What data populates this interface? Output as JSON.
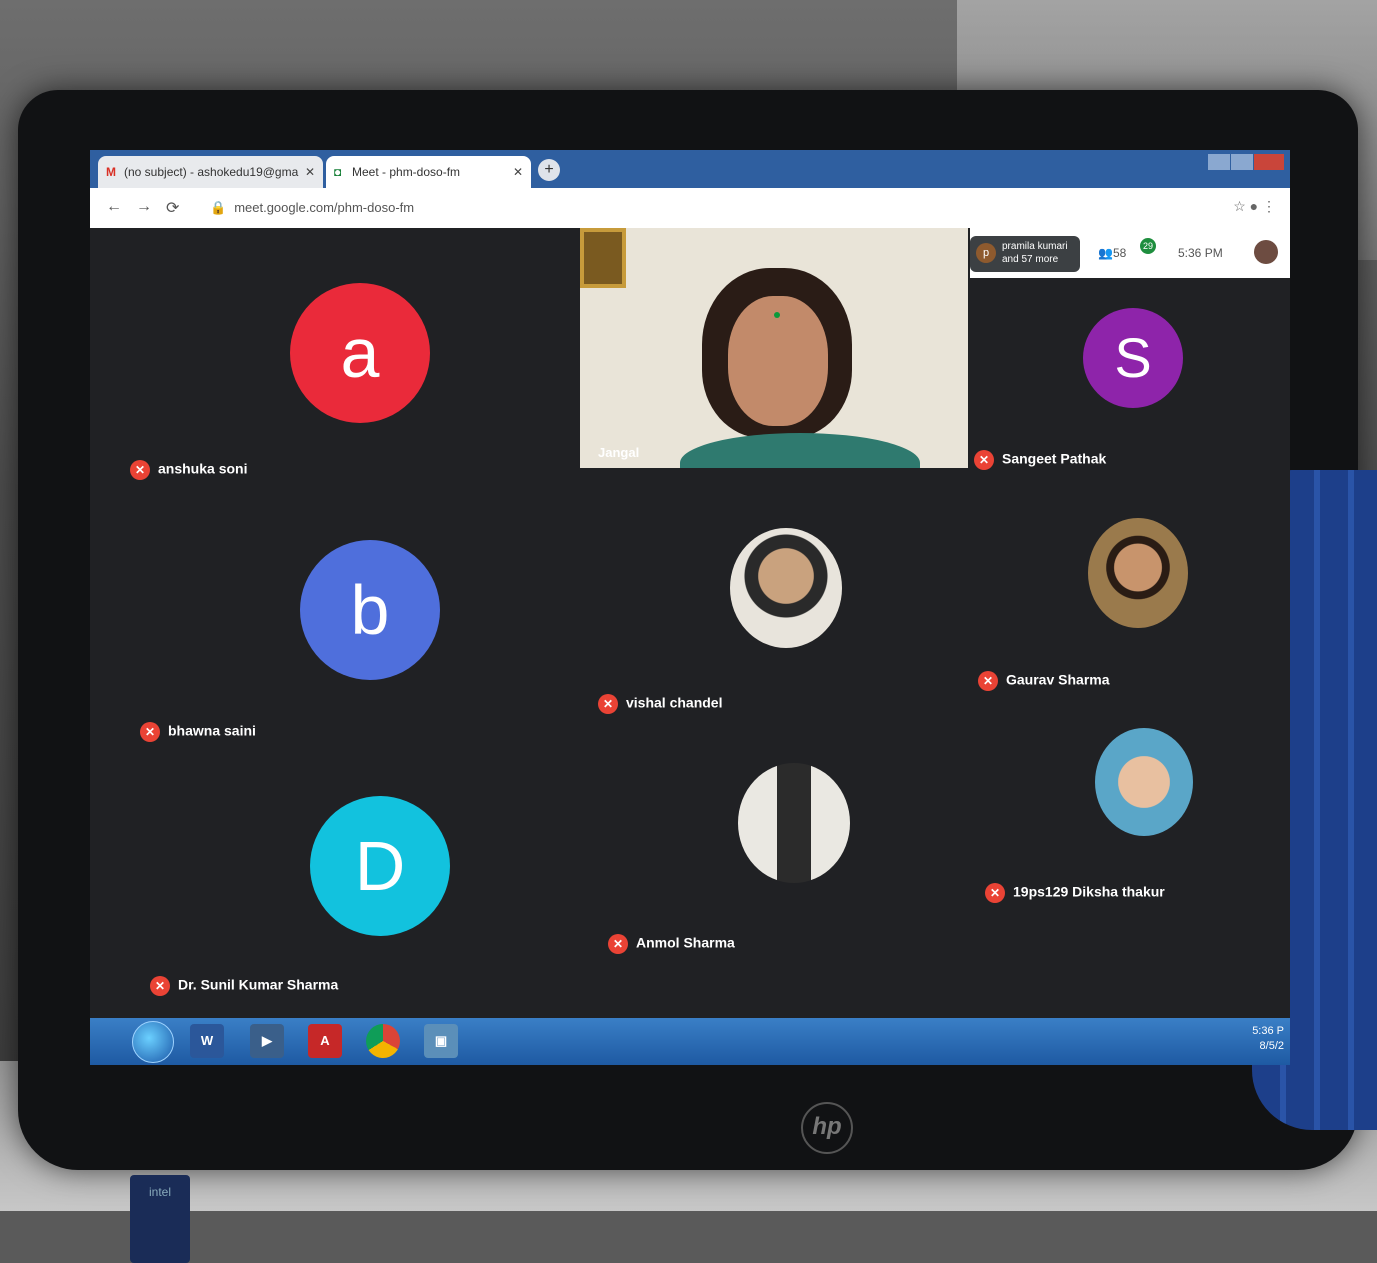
{
  "browser": {
    "tabs": [
      {
        "label": "(no subject) - ashokedu19@gma",
        "icon": "gmail-icon"
      },
      {
        "label": "Meet - phm-doso-fm",
        "icon": "meet-icon"
      }
    ],
    "url": "meet.google.com/phm-doso-fm"
  },
  "meet": {
    "participants": [
      {
        "name": "anshuka soni",
        "initial": "a",
        "color": "#ea2a3a"
      },
      {
        "name": "bhawna saini",
        "initial": "b",
        "color": "#4f6fdc"
      },
      {
        "name": "Dr. Sunil Kumar Sharma",
        "initial": "D",
        "color": "#12c2de"
      },
      {
        "name": "Sangeet Pathak",
        "initial": "S",
        "color": "#8e24aa"
      },
      {
        "name": "vishal chandel"
      },
      {
        "name": "Gaurav Sharma"
      },
      {
        "name": "Anmol Sharma"
      },
      {
        "name": "19ps129 Diksha thakur"
      }
    ],
    "speaker_label": "Jangal",
    "people_chip": {
      "initial": "p",
      "line1": "pramila kumari",
      "line2": "and 57 more"
    },
    "people_count": "58",
    "participants_count": "29",
    "time": "5:36 PM"
  },
  "taskbar": {
    "apps": [
      "start-button",
      "word-icon",
      "video-icon",
      "acrobat-icon",
      "chrome-icon",
      "remote-desktop-icon"
    ],
    "tray_time": "5:36 P",
    "tray_date": "8/5/2"
  },
  "device": {
    "brand": "hp",
    "sticker": "intel"
  }
}
